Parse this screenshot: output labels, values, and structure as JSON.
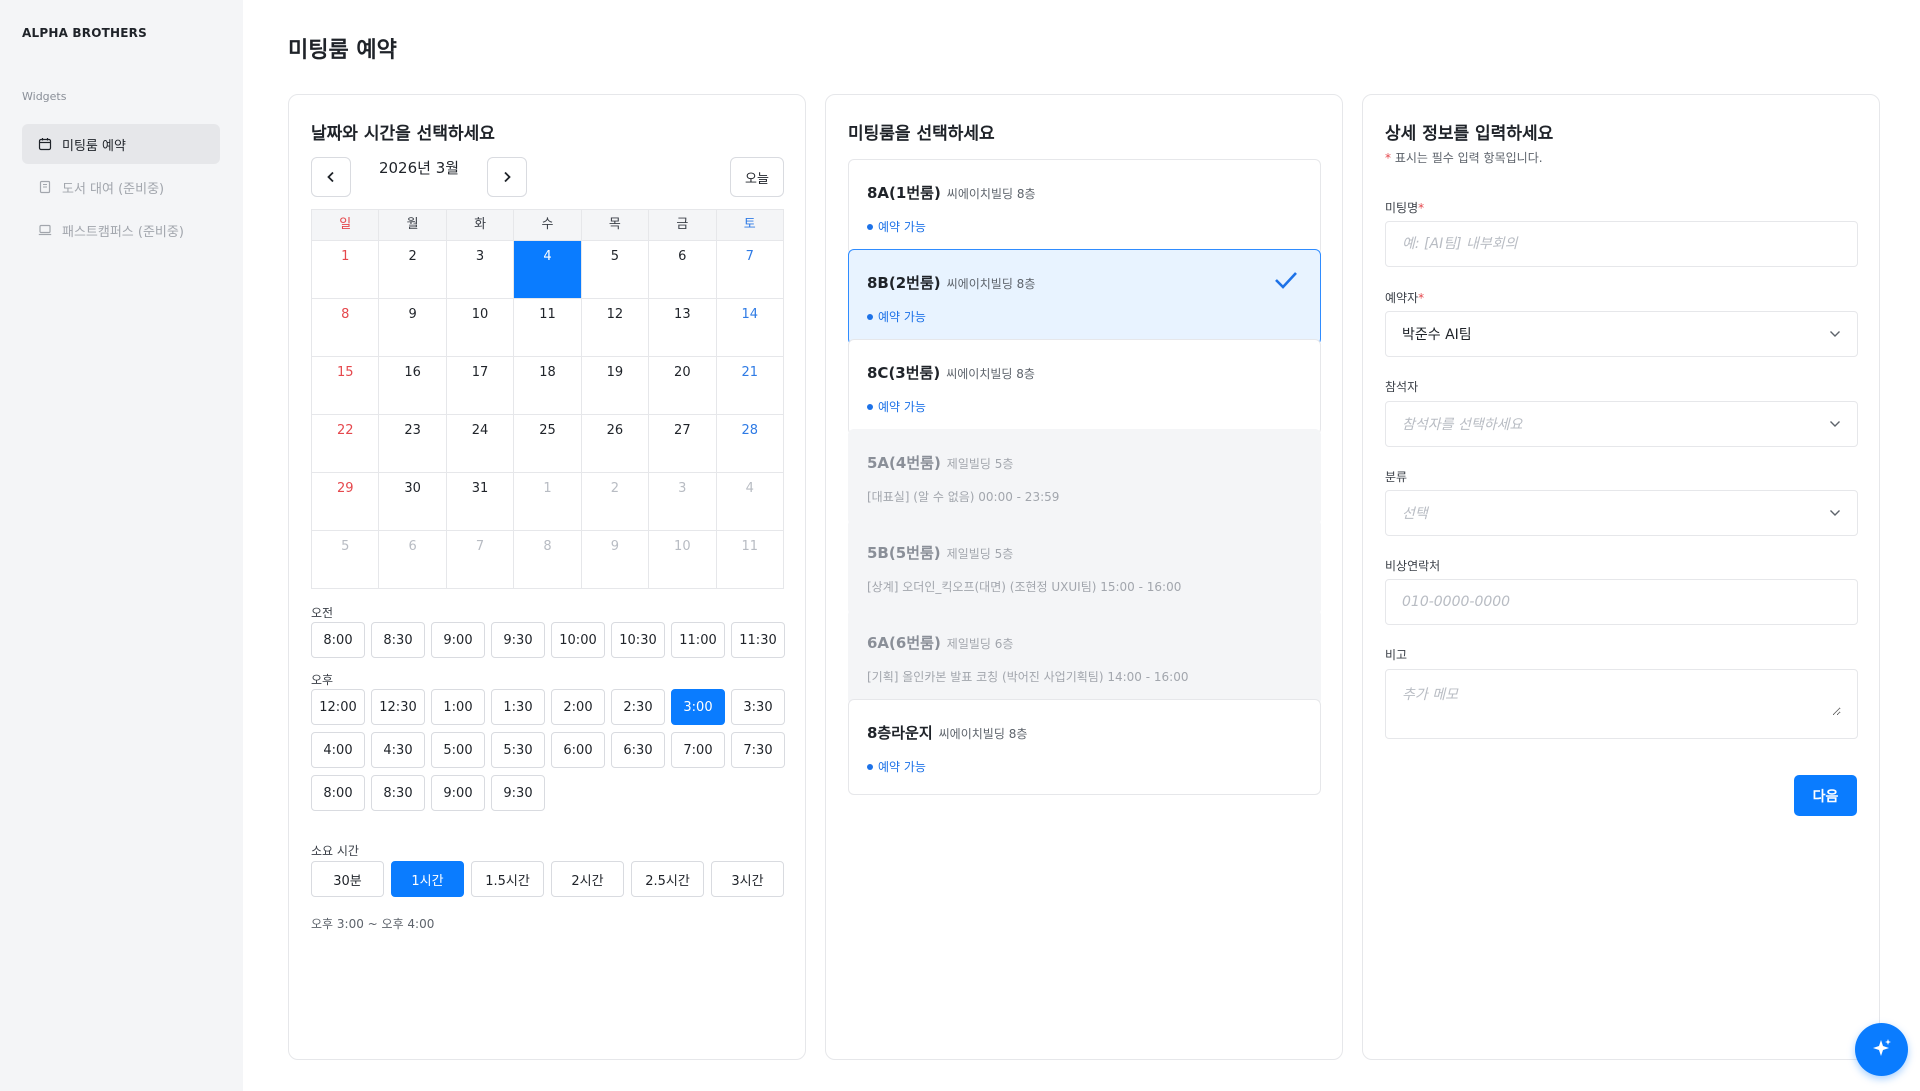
{
  "sidebar": {
    "brand": "ALPHA BROTHERS",
    "section": "Widgets",
    "items": [
      {
        "label": "미팅룸 예약",
        "icon": "calendar-icon",
        "state": "active"
      },
      {
        "label": "도서 대여 (준비중)",
        "icon": "book-icon",
        "state": "disabled"
      },
      {
        "label": "패스트캠퍼스 (준비중)",
        "icon": "laptop-icon",
        "state": "disabled"
      }
    ]
  },
  "page": {
    "title": "미팅룸 예약"
  },
  "calendar": {
    "title": "날짜와 시간을 선택하세요",
    "month": "2026년 3월",
    "today": "오늘",
    "weekdays": [
      "일",
      "월",
      "화",
      "수",
      "목",
      "금",
      "토"
    ],
    "weeks": [
      [
        "1",
        "2",
        "3",
        "4",
        "5",
        "6",
        "7"
      ],
      [
        "8",
        "9",
        "10",
        "11",
        "12",
        "13",
        "14"
      ],
      [
        "15",
        "16",
        "17",
        "18",
        "19",
        "20",
        "21"
      ],
      [
        "22",
        "23",
        "24",
        "25",
        "26",
        "27",
        "28"
      ],
      [
        "29",
        "30",
        "31",
        "1",
        "2",
        "3",
        "4"
      ],
      [
        "5",
        "6",
        "7",
        "8",
        "9",
        "10",
        "11"
      ]
    ],
    "selected_date": "4",
    "am_label": "오전",
    "am_slots": [
      "8:00",
      "8:30",
      "9:00",
      "9:30",
      "10:00",
      "10:30",
      "11:00",
      "11:30"
    ],
    "pm_label": "오후",
    "pm_slots": [
      "12:00",
      "12:30",
      "1:00",
      "1:30",
      "2:00",
      "2:30",
      "3:00",
      "3:30",
      "4:00",
      "4:30",
      "5:00",
      "5:30",
      "6:00",
      "6:30",
      "7:00",
      "7:30",
      "8:00",
      "8:30",
      "9:00",
      "9:30"
    ],
    "selected_slot": "3:00",
    "duration_label": "소요 시간",
    "durations": [
      "30분",
      "1시간",
      "1.5시간",
      "2시간",
      "2.5시간",
      "3시간"
    ],
    "selected_duration": "1시간",
    "range": "오후 3:00 ~ 오후 4:00"
  },
  "rooms": {
    "title": "미팅룸을 선택하세요",
    "items": [
      {
        "name": "8A(1번룸)",
        "location": "씨에이치빌딩 8층",
        "status": "예약 가능",
        "state": "available"
      },
      {
        "name": "8B(2번룸)",
        "location": "씨에이치빌딩 8층",
        "status": "예약 가능",
        "state": "selected"
      },
      {
        "name": "8C(3번룸)",
        "location": "씨에이치빌딩 8층",
        "status": "예약 가능",
        "state": "available"
      },
      {
        "name": "5A(4번룸)",
        "location": "제일빌딩 5층",
        "status": "[대표실] (알 수 없음) 00:00 - 23:59",
        "state": "unavailable"
      },
      {
        "name": "5B(5번룸)",
        "location": "제일빌딩 5층",
        "status": "[상계] 오더인_킥오프(대면) (조현정 UXUI팀) 15:00 - 16:00",
        "state": "unavailable"
      },
      {
        "name": "6A(6번룸)",
        "location": "제일빌딩 6층",
        "status": "[기획] 올인카본 발표 코칭 (박어진 사업기획팀) 14:00 - 16:00",
        "state": "unavailable"
      },
      {
        "name": "8층라운지",
        "location": "씨에이치빌딩 8층",
        "status": "예약 가능",
        "state": "available"
      }
    ]
  },
  "form": {
    "title": "상세 정보를 입력하세요",
    "required_note_star": "*",
    "required_note": " 표시는 필수 입력 항목입니다.",
    "meeting_name_label": "미팅명",
    "meeting_name_placeholder": "예: [AI팀] 내부회의",
    "booker_label": "예약자",
    "booker_value": "박준수 AI팀",
    "attendees_label": "참석자",
    "attendees_placeholder": "참석자를 선택하세요",
    "category_label": "분류",
    "category_placeholder": "선택",
    "emergency_label": "비상연락처",
    "emergency_placeholder": "010-0000-0000",
    "memo_label": "비고",
    "memo_placeholder": "추가 메모",
    "required_star": "*",
    "next": "다음"
  },
  "colors": {
    "accent": "#0a7cff",
    "sunday": "#e5484d",
    "saturday": "#2f7be5"
  }
}
